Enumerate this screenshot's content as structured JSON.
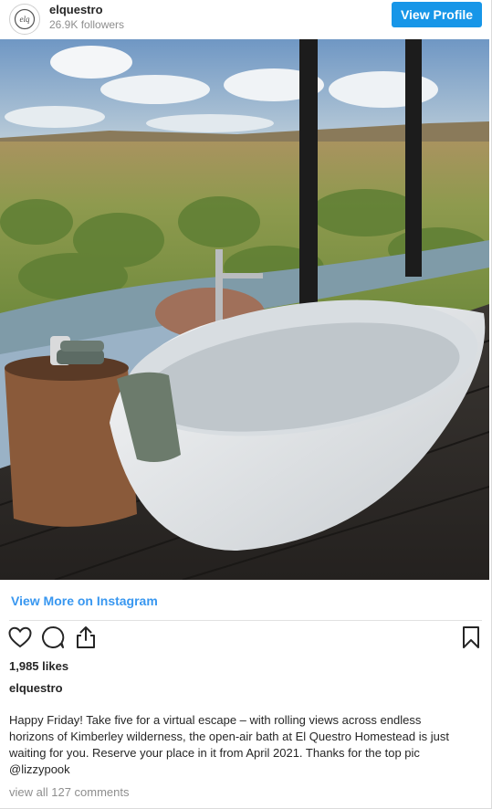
{
  "header": {
    "avatar_icon": "elq-logo-icon",
    "username": "elquestro",
    "followers": "26.9K followers",
    "view_profile_label": "View Profile"
  },
  "post": {
    "image_alt_icon": "user-tag-icon",
    "view_more_label": "View More on Instagram",
    "actions": [
      "heart-icon",
      "comment-icon",
      "share-icon",
      "bookmark-icon"
    ],
    "likes": "1,985 likes",
    "caption_username": "elquestro",
    "caption_lines": [
      "Happy Friday! Take five for a virtual escape – with rolling views across endless",
      "horizons of Kimberley wilderness, the open-air bath at El Questro Homestead is just",
      "waiting for you. Reserve your place in it from April 2021. Thanks for the top pic",
      "@lizzypook"
    ],
    "comments_link": "view all 127 comments"
  },
  "colors": {
    "accent": "#1796e8",
    "link": "#3897f0",
    "muted": "#8e8e8e"
  }
}
